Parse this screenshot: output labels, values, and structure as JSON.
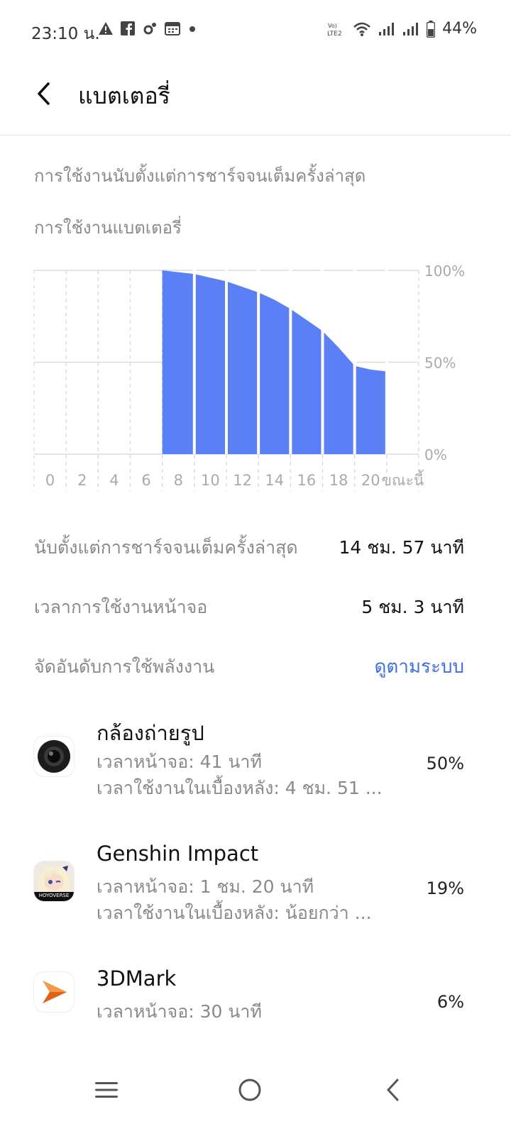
{
  "status_bar": {
    "time": "23:10 น.",
    "battery_percent": "44%",
    "left_icons": [
      "warning-icon",
      "facebook-icon",
      "settings-icon",
      "calendar-icon",
      "dot-icon"
    ],
    "right_icons": [
      "volte-lte2-icon",
      "wifi-icon",
      "signal-icon",
      "signal-icon",
      "battery-icon"
    ]
  },
  "header": {
    "title": "แบตเตอรี่"
  },
  "section": {
    "since_full_charge": "การใช้งานนับตั้งแต่การชาร์จจนเต็มครั้งล่าสุด",
    "battery_usage": "การใช้งานแบตเตอรี่"
  },
  "chart_data": {
    "type": "area",
    "x_tick_labels": [
      "0",
      "2",
      "4",
      "6",
      "8",
      "10",
      "12",
      "14",
      "16",
      "18",
      "20",
      "ขณะนี้"
    ],
    "y_tick_labels": [
      "100%",
      "50%",
      "0%"
    ],
    "ylim": [
      0,
      100
    ],
    "x": [
      8,
      9,
      10,
      11,
      12,
      13,
      14,
      15,
      16,
      17,
      18,
      19,
      20,
      21,
      22
    ],
    "values": [
      100,
      99,
      98,
      96,
      94,
      91,
      88,
      84,
      79,
      73,
      67,
      58,
      48,
      46,
      45
    ],
    "fill_color": "#5b7ff5",
    "grid": true
  },
  "stats": {
    "since_full_label": "นับตั้งแต่การชาร์จจนเต็มครั้งล่าสุด",
    "since_full_value": "14 ชม. 57 นาที",
    "screen_time_label": "เวลาการใช้งานหน้าจอ",
    "screen_time_value": "5 ชม. 3 นาที"
  },
  "ranking": {
    "label": "จัดอันดับการใช้พลังงาน",
    "link": "ดูตามระบบ"
  },
  "apps": [
    {
      "name": "กล้องถ่ายรูป",
      "screen_time": "เวลาหน้าจอ: 41 นาที",
      "background_time": "เวลาใช้งานในเบื้องหลัง: 4 ชม. 51 ...",
      "percent": "50%",
      "icon": "camera-icon"
    },
    {
      "name": "Genshin Impact",
      "screen_time": "เวลาหน้าจอ: 1 ชม. 20 นาที",
      "background_time": "เวลาใช้งานในเบื้องหลัง: น้อยกว่า ...",
      "percent": "19%",
      "icon": "genshin-impact-icon",
      "icon_text": "HOYOVERSE"
    },
    {
      "name": "3DMark",
      "screen_time": "เวลาหน้าจอ: 30 นาที",
      "percent": "6%",
      "icon": "3dmark-icon"
    }
  ],
  "nav_bar": {
    "icons": [
      "menu-icon",
      "home-icon",
      "back-icon"
    ]
  }
}
